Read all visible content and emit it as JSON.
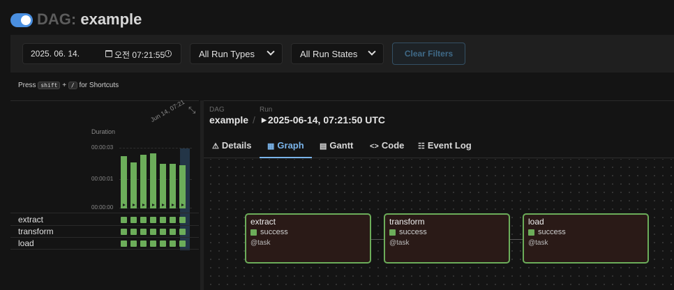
{
  "header": {
    "dag_prefix": "DAG:",
    "dag_name": "example",
    "toggle_on": true
  },
  "filters": {
    "date_value": "2025. 06. 14.",
    "time_value": "오전 07:21:55",
    "run_types": "All Run Types",
    "run_states": "All Run States",
    "clear_label": "Clear Filters"
  },
  "hint": {
    "press": "Press",
    "key1": "shift",
    "plus": "+",
    "key2": "/",
    "suffix": "for Shortcuts"
  },
  "grid": {
    "duration_label": "Duration",
    "run_date_label": "Jun 14, 07:21",
    "y_ticks": [
      "00:00:03",
      "00:00:01",
      "00:00:00"
    ],
    "durations_sec": [
      3.4,
      3.0,
      3.5,
      3.6,
      2.9,
      2.9,
      2.8
    ],
    "y_max_sec": 4.0,
    "tasks": [
      {
        "name": "extract",
        "states": [
          "success",
          "success",
          "success",
          "success",
          "success",
          "success",
          "success"
        ]
      },
      {
        "name": "transform",
        "states": [
          "success",
          "success",
          "success",
          "success",
          "success",
          "success",
          "success"
        ]
      },
      {
        "name": "load",
        "states": [
          "success",
          "success",
          "success",
          "success",
          "success",
          "success",
          "success"
        ]
      }
    ]
  },
  "breadcrumb": {
    "dag_label": "DAG",
    "dag_value": "example",
    "run_label": "Run",
    "run_value": "2025-06-14, 07:21:50 UTC"
  },
  "tabs": [
    {
      "label": "Details",
      "icon": "warning-icon"
    },
    {
      "label": "Graph",
      "icon": "graph-icon",
      "active": true
    },
    {
      "label": "Gantt",
      "icon": "gantt-icon"
    },
    {
      "label": "Code",
      "icon": "code-icon"
    },
    {
      "label": "Event Log",
      "icon": "event-log-icon"
    }
  ],
  "graph": {
    "nodes": [
      {
        "name": "extract",
        "status": "success",
        "operator": "@task"
      },
      {
        "name": "transform",
        "status": "success",
        "operator": "@task"
      },
      {
        "name": "load",
        "status": "success",
        "operator": "@task"
      }
    ]
  },
  "colors": {
    "success": "#6cad5a",
    "accent": "#7ab4ea",
    "toggle": "#4a8fe0"
  }
}
